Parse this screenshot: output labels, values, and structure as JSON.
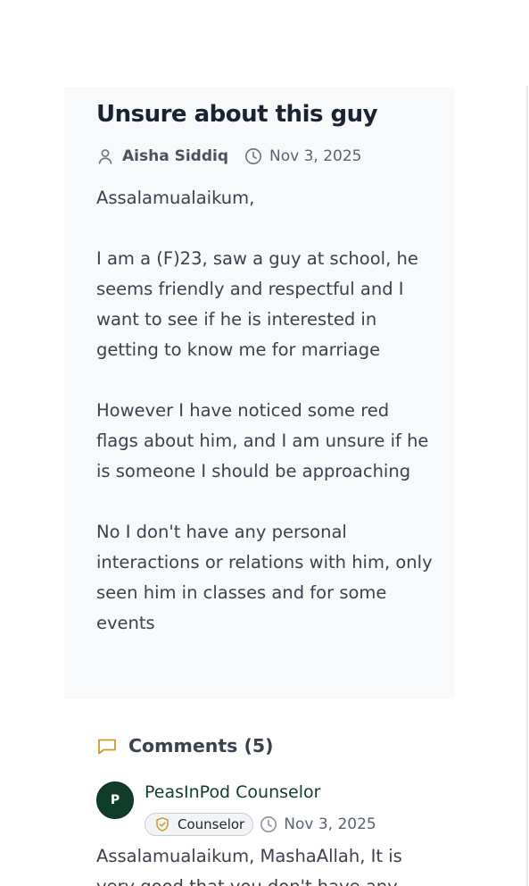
{
  "post": {
    "title": "Unsure about this guy",
    "author": "Aisha Siddiq",
    "date": "Nov 3, 2025",
    "body": [
      "Assalamualaikum,",
      "I am a (F)23, saw a guy at school, he seems friendly and respectful and I want to see if he is interested in getting to know me for marriage",
      "However I have noticed some red flags about him, and I am unsure if he is someone I should be approaching",
      "No I don't have any personal interactions or relations with him, only seen him in classes and for some events"
    ]
  },
  "comments": {
    "header": "Comments (5)",
    "items": [
      {
        "avatar_initial": "P",
        "name": "PeasInPod Counselor",
        "badge": "Counselor",
        "date": "Nov 3, 2025",
        "text": "Assalamualaikum, MashaAllah, It is very good that you don't have any"
      }
    ]
  },
  "colors": {
    "accent_gold": "#c99a2e",
    "brand_green": "#0f3d2a",
    "card_bg": "#f7f9fb",
    "text_dark": "#1a2330",
    "text_body": "#3a424e",
    "text_muted": "#5a6370"
  },
  "icons": {
    "author": "user-icon",
    "date": "clock-icon",
    "comments": "message-square-icon",
    "badge": "shield-check-icon"
  }
}
